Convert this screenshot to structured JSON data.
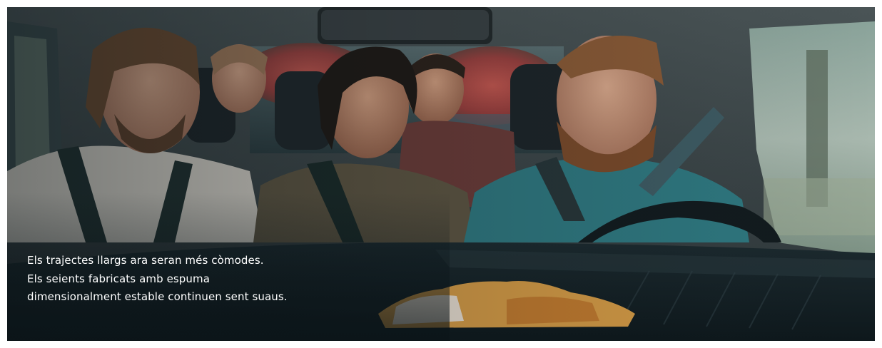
{
  "hero": {
    "image_alt": "Quatre persones assegudes dins d'un cotxe",
    "caption_lines": [
      "Els trajectes llargs ara seran més còmodes.",
      "Els seients fabricats amb espuma",
      "dimensionalment estable continuen sent suaus."
    ]
  }
}
